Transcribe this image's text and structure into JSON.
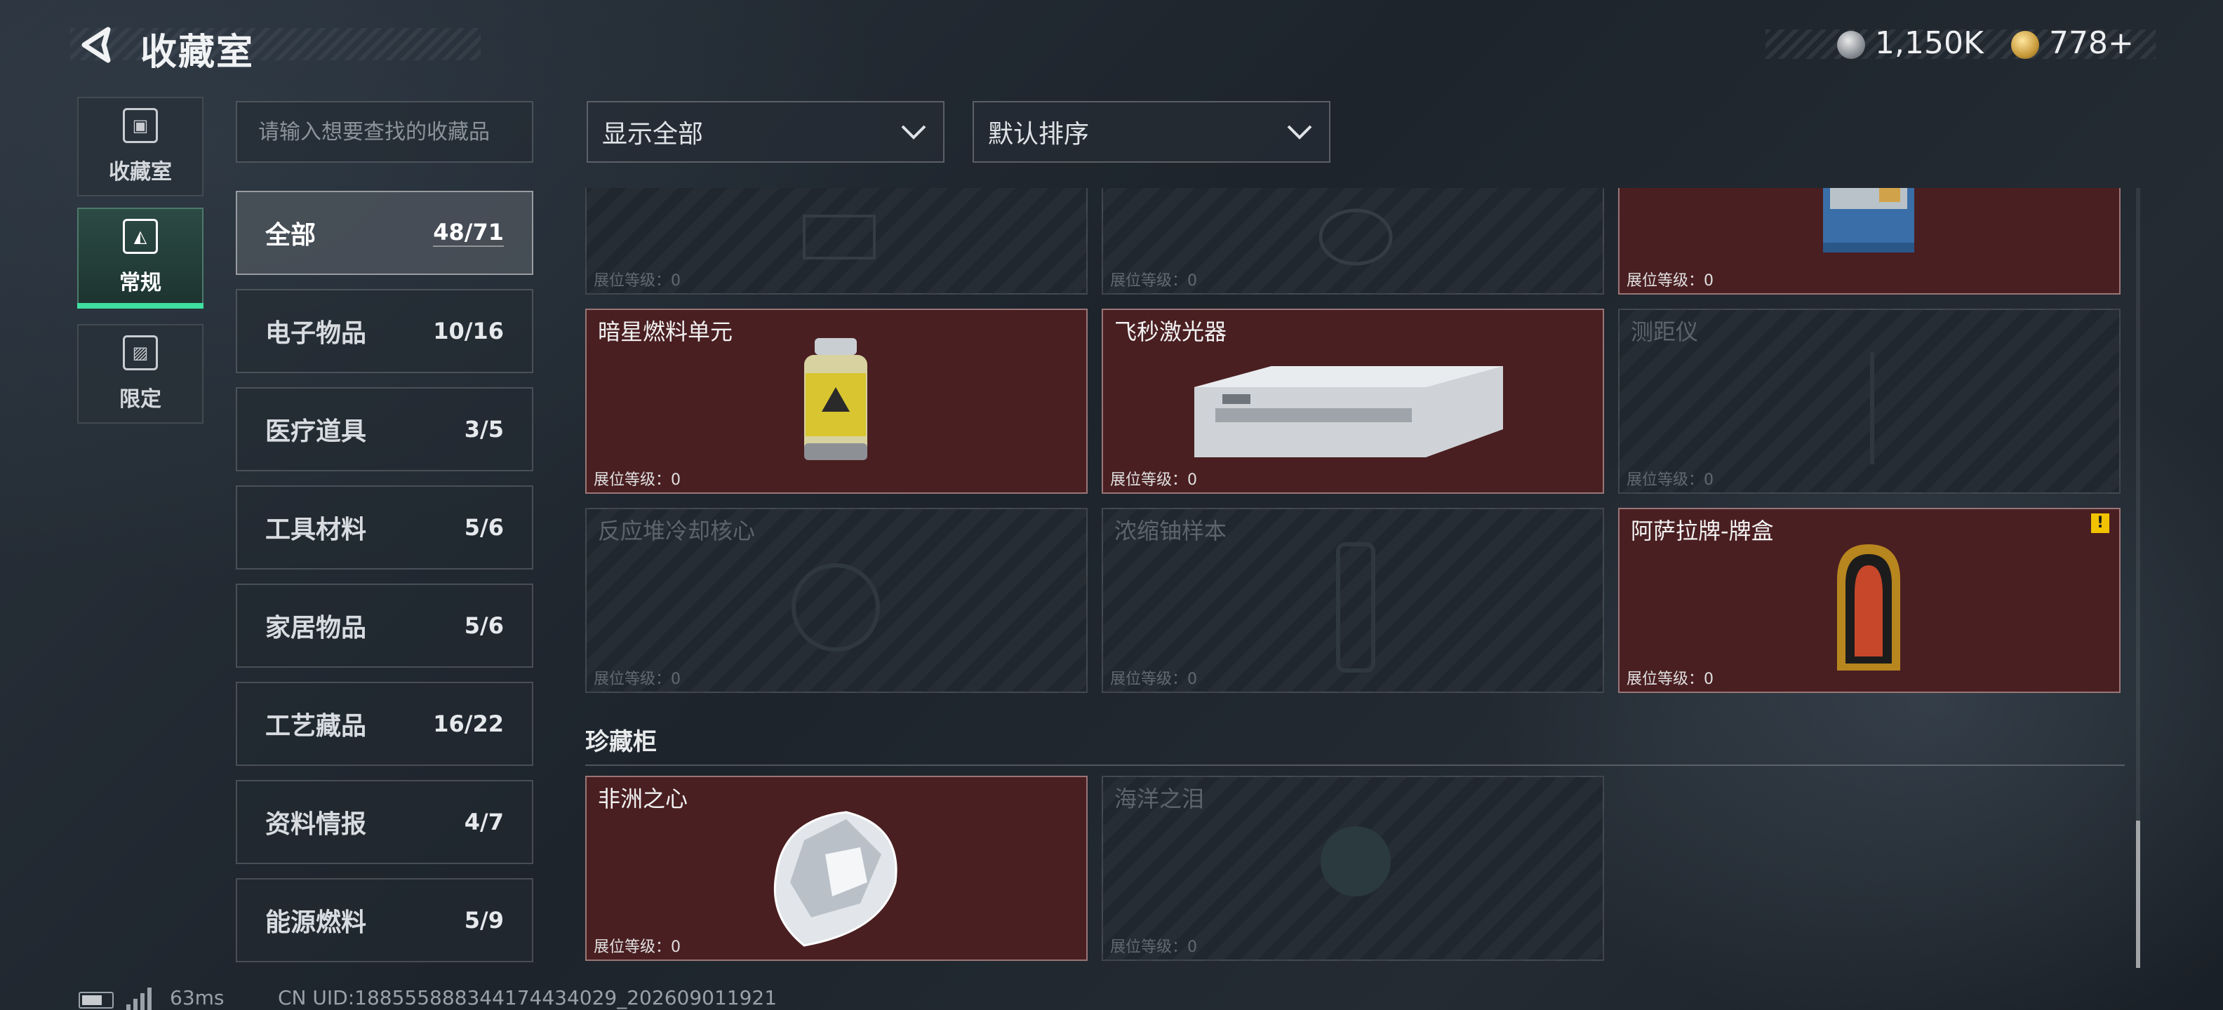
{
  "header": {
    "title": "收藏室"
  },
  "currency": [
    {
      "icon": "silver-coin-icon",
      "value": "1,150K"
    },
    {
      "icon": "gold-coin-icon",
      "value": "778+"
    }
  ],
  "side_tabs": [
    {
      "label": "收藏室",
      "icon": "collection-room-icon",
      "active": false
    },
    {
      "label": "常规",
      "icon": "regular-icon",
      "active": true
    },
    {
      "label": "限定",
      "icon": "limited-icon",
      "active": false
    }
  ],
  "search": {
    "placeholder": "请输入想要查找的收藏品"
  },
  "categories": [
    {
      "name": "全部",
      "count": "48/71",
      "active": true
    },
    {
      "name": "电子物品",
      "count": "10/16"
    },
    {
      "name": "医疗道具",
      "count": "3/5"
    },
    {
      "name": "工具材料",
      "count": "5/6"
    },
    {
      "name": "家居物品",
      "count": "5/6"
    },
    {
      "name": "工艺藏品",
      "count": "16/22"
    },
    {
      "name": "资料情报",
      "count": "4/7"
    },
    {
      "name": "能源燃料",
      "count": "5/9"
    }
  ],
  "filters": {
    "display": "显示全部",
    "sort": "默认排序"
  },
  "level_label": "展位等级：0",
  "items": [
    {
      "name": "",
      "owned": false,
      "art": "chip-icon"
    },
    {
      "name": "",
      "owned": false,
      "art": "lens-icon"
    },
    {
      "name": "",
      "owned": true,
      "art": "machine-icon"
    },
    {
      "name": "暗星燃料单元",
      "owned": true,
      "art": "fuel-cell-icon"
    },
    {
      "name": "飞秒激光器",
      "owned": true,
      "art": "laser-icon"
    },
    {
      "name": "测距仪",
      "owned": false,
      "art": "rangefinder-icon"
    },
    {
      "name": "反应堆冷却核心",
      "owned": false,
      "art": "reactor-core-icon"
    },
    {
      "name": "浓缩铀样本",
      "owned": false,
      "art": "uranium-icon"
    },
    {
      "name": "阿萨拉牌-牌盒",
      "owned": true,
      "art": "card-box-icon",
      "warning": "!"
    }
  ],
  "section": {
    "title": "珍藏柜"
  },
  "cabinet": [
    {
      "name": "非洲之心",
      "owned": true,
      "art": "diamond-icon"
    },
    {
      "name": "海洋之泪",
      "owned": false,
      "art": "pearl-icon"
    }
  ],
  "footer": {
    "ping": "63ms",
    "uid": "CN UID:188555888344174434029_202609011921"
  }
}
